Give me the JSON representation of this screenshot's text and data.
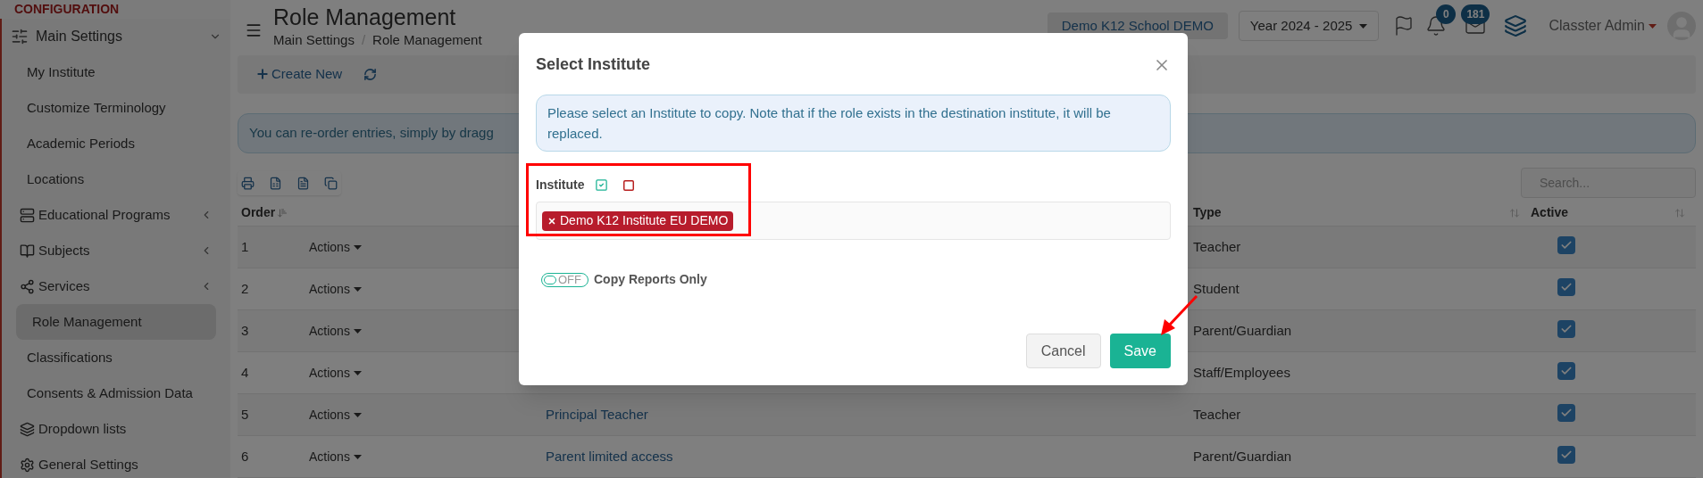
{
  "sidebar": {
    "heading": "CONFIGURATION",
    "sections": [
      {
        "label": "Main Settings",
        "expanded": true,
        "children": [
          {
            "label": "My Institute",
            "kind": "link",
            "selected": false
          },
          {
            "label": "Customize Terminology",
            "kind": "link",
            "selected": false
          },
          {
            "label": "Academic Periods",
            "kind": "link",
            "selected": false
          },
          {
            "label": "Locations",
            "kind": "link",
            "selected": false
          },
          {
            "label": "Educational Programs",
            "kind": "group",
            "expanded": false,
            "selected": false
          },
          {
            "label": "Subjects",
            "kind": "group",
            "expanded": false,
            "selected": false
          },
          {
            "label": "Services",
            "kind": "group",
            "expanded": false,
            "selected": false
          },
          {
            "label": "Role Management",
            "kind": "link",
            "selected": true
          },
          {
            "label": "Classifications",
            "kind": "link",
            "selected": false
          },
          {
            "label": "Consents & Admission Data",
            "kind": "link",
            "selected": false
          },
          {
            "label": "Dropdown lists",
            "kind": "icon_link",
            "selected": false
          },
          {
            "label": "General Settings",
            "kind": "icon_link",
            "selected": false
          }
        ]
      }
    ]
  },
  "header": {
    "title": "Role Management",
    "breadcrumb": [
      "Main Settings",
      "Role Management"
    ],
    "separator": "/",
    "school": "Demo K12 School DEMO",
    "year": "Year 2024 - 2025",
    "notifications": "0",
    "messages": "181",
    "user": "Classter Admin"
  },
  "toolbar": {
    "create": "Create New"
  },
  "info": "You can re-order entries, simply by dragg",
  "search": {
    "placeholder": "Search..."
  },
  "table": {
    "columns": [
      {
        "label": "Order"
      },
      {
        "label": "Type"
      },
      {
        "label": "Active"
      }
    ],
    "rows": [
      {
        "order": "1",
        "actions": "Actions",
        "type": "Teacher",
        "active": true
      },
      {
        "order": "2",
        "actions": "Actions",
        "type": "Student",
        "active": true
      },
      {
        "order": "3",
        "actions": "Actions",
        "type": "Parent/Guardian",
        "active": true
      },
      {
        "order": "4",
        "actions": "Actions",
        "type": "Staff/Employees",
        "active": true
      },
      {
        "order": "5",
        "actions": "Actions",
        "name": "Principal Teacher",
        "type": "Teacher",
        "active": true
      },
      {
        "order": "6",
        "actions": "Actions",
        "name": "Parent limited access",
        "type": "Parent/Guardian",
        "active": true
      }
    ]
  },
  "dialog": {
    "title": "Select Institute",
    "message": "Please select an Institute to copy. Note that if the role exists in the destination institute, it will be replaced.",
    "field_label": "Institute",
    "tags": [
      "Demo K12 Institute EU DEMO"
    ],
    "toggle": {
      "on": false,
      "text": "OFF",
      "label": "Copy Reports Only"
    },
    "buttons": [
      {
        "label": "Cancel",
        "kind": "secondary"
      },
      {
        "label": "Save",
        "kind": "primary"
      }
    ]
  }
}
